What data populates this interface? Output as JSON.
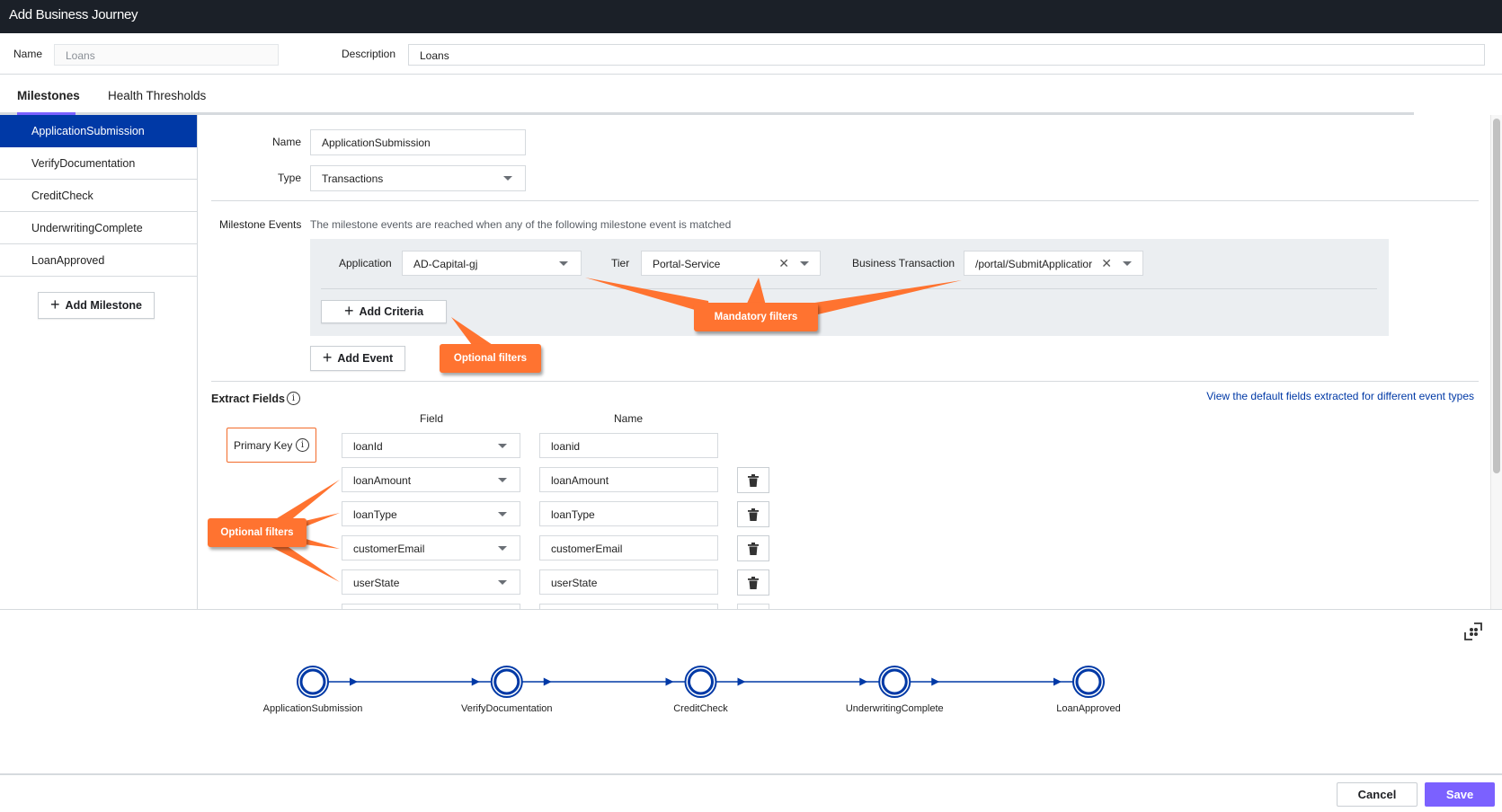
{
  "window": {
    "title": "Add Business Journey"
  },
  "journey": {
    "name_label": "Name",
    "name_value": "Loans",
    "description_label": "Description",
    "description_value": "Loans"
  },
  "tabs": [
    {
      "label": "Milestones",
      "active": true
    },
    {
      "label": "Health Thresholds",
      "active": false
    }
  ],
  "sidebar": {
    "milestones": [
      {
        "label": "ApplicationSubmission",
        "active": true
      },
      {
        "label": "VerifyDocumentation",
        "active": false
      },
      {
        "label": "CreditCheck",
        "active": false
      },
      {
        "label": "UnderwritingComplete",
        "active": false
      },
      {
        "label": "LoanApproved",
        "active": false
      }
    ],
    "add_milestone_label": "Add Milestone"
  },
  "milestone": {
    "name_label": "Name",
    "name_value": "ApplicationSubmission",
    "type_label": "Type",
    "type_value": "Transactions",
    "events_label": "Milestone Events",
    "events_description": "The milestone events are reached when any of the following milestone event is matched",
    "event": {
      "application_label": "Application",
      "application_value": "AD-Capital-gj",
      "tier_label": "Tier",
      "tier_value": "Portal-Service",
      "bt_label": "Business Transaction",
      "bt_value": "/portal/SubmitApplicatior"
    },
    "add_criteria_label": "Add Criteria",
    "add_event_label": "Add Event"
  },
  "extract_fields": {
    "title": "Extract Fields",
    "view_defaults_link": "View the default fields extracted for different event types",
    "field_header": "Field",
    "name_header": "Name",
    "primary_key_label": "Primary Key",
    "rows": [
      {
        "field": "loanId",
        "name": "loanid",
        "deletable": false
      },
      {
        "field": "loanAmount",
        "name": "loanAmount",
        "deletable": true
      },
      {
        "field": "loanType",
        "name": "loanType",
        "deletable": true
      },
      {
        "field": "customerEmail",
        "name": "customerEmail",
        "deletable": true
      },
      {
        "field": "userState",
        "name": "userState",
        "deletable": true
      }
    ]
  },
  "annotations": {
    "mandatory": "Mandatory filters",
    "optional_criteria": "Optional filters",
    "optional_fields": "Optional filters"
  },
  "flow": {
    "nodes": [
      "ApplicationSubmission",
      "VerifyDocumentation",
      "CreditCheck",
      "UnderwritingComplete",
      "LoanApproved"
    ]
  },
  "footer": {
    "cancel_label": "Cancel",
    "save_label": "Save"
  },
  "colors": {
    "accent": "#7b61ff",
    "selected": "#0039a6",
    "callout": "#ff7330",
    "topbar": "#1b2028"
  }
}
